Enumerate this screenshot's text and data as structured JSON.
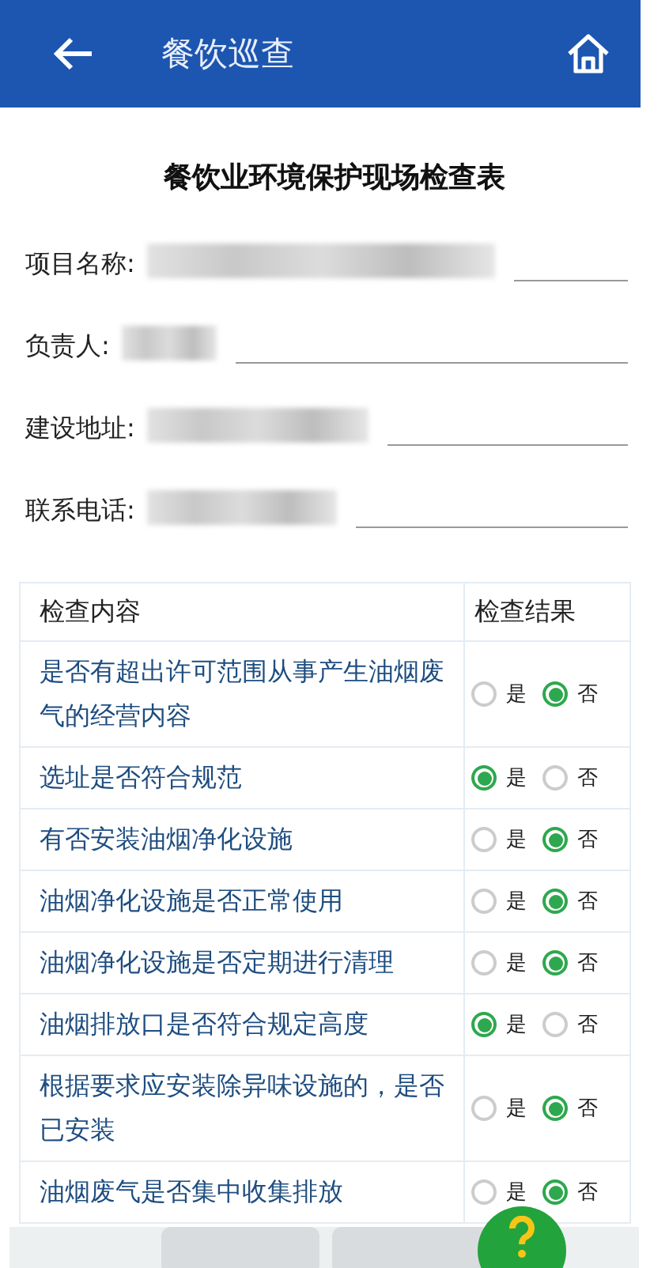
{
  "header": {
    "title": "餐饮巡查"
  },
  "form_title": "餐饮业环境保护现场检查表",
  "fields": [
    {
      "label": "项目名称:"
    },
    {
      "label": "负责人:"
    },
    {
      "label": "建设地址:"
    },
    {
      "label": "联系电话:"
    }
  ],
  "table": {
    "columns": [
      "检查内容",
      "检查结果"
    ],
    "rows": [
      {
        "item": "是否有超出许可范围从事产生油烟废气的经营内容",
        "options": [
          {
            "label": "是",
            "selected": false
          },
          {
            "label": "否",
            "selected": true
          }
        ]
      },
      {
        "item": "选址是否符合规范",
        "options": [
          {
            "label": "是",
            "selected": true
          },
          {
            "label": "否",
            "selected": false
          }
        ]
      },
      {
        "item": "有否安装油烟净化设施",
        "options": [
          {
            "label": "是",
            "selected": false
          },
          {
            "label": "否",
            "selected": true
          }
        ]
      },
      {
        "item": "油烟净化设施是否正常使用",
        "options": [
          {
            "label": "是",
            "selected": false
          },
          {
            "label": "否",
            "selected": true
          }
        ]
      },
      {
        "item": "油烟净化设施是否定期进行清理",
        "options": [
          {
            "label": "是",
            "selected": false
          },
          {
            "label": "否",
            "selected": true
          }
        ]
      },
      {
        "item": "油烟排放口是否符合规定高度",
        "options": [
          {
            "label": "是",
            "selected": true
          },
          {
            "label": "否",
            "selected": false
          }
        ]
      },
      {
        "item": "根据要求应安装除异味设施的，是否已安装",
        "options": [
          {
            "label": "是",
            "selected": false
          },
          {
            "label": "否",
            "selected": true
          }
        ]
      },
      {
        "item": "油烟废气是否集中收集排放",
        "options": [
          {
            "label": "是",
            "selected": false
          },
          {
            "label": "否",
            "selected": true
          }
        ]
      }
    ]
  }
}
